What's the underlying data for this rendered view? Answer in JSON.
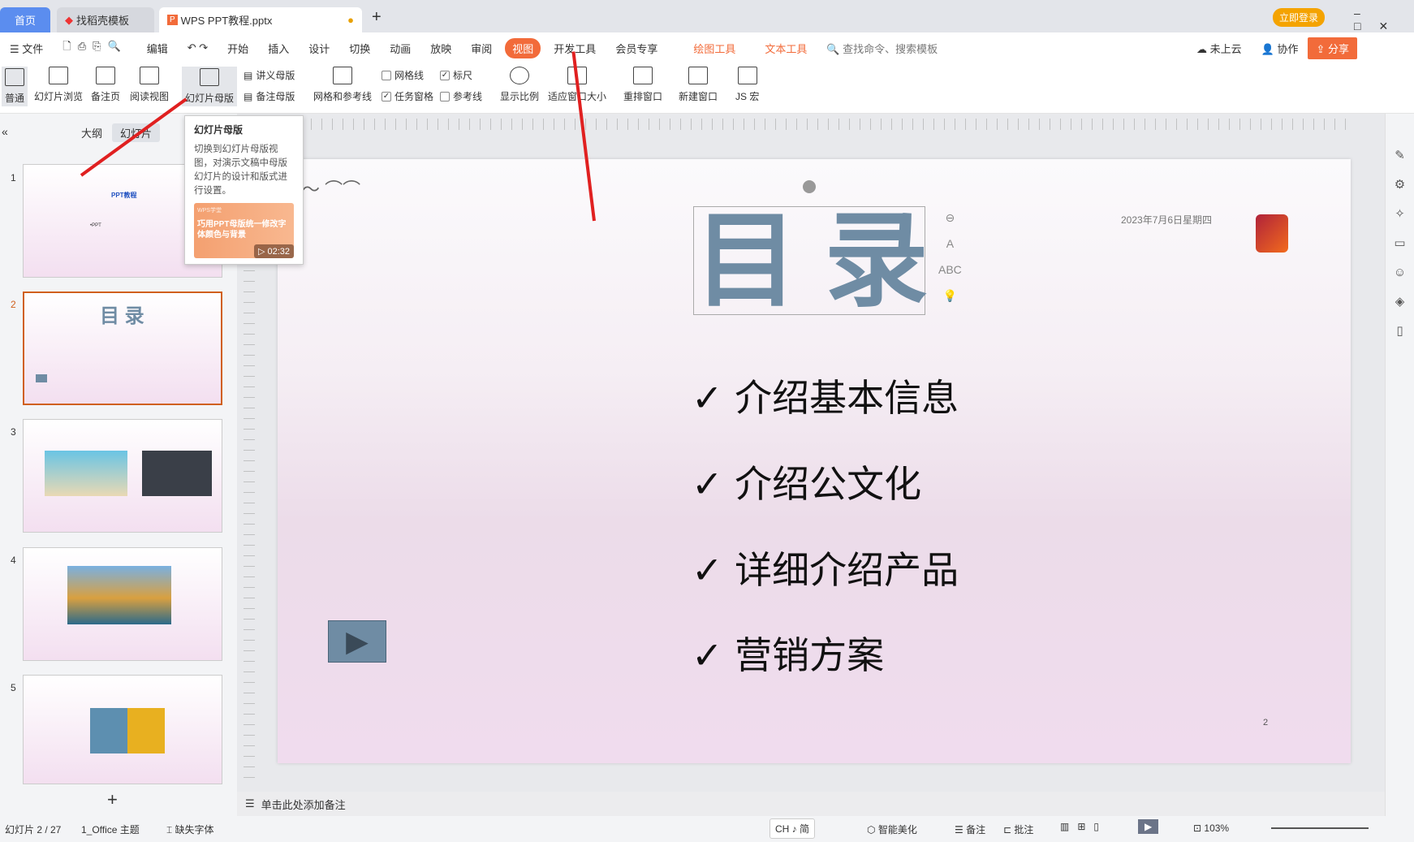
{
  "tabs": [
    {
      "label": "首页"
    },
    {
      "label": "找稻壳模板"
    },
    {
      "label": "WPS PPT教程.pptx"
    }
  ],
  "titlebar": {
    "login": "立即登录",
    "new_tab": "+"
  },
  "menu": {
    "file": "文件",
    "edit": "编辑",
    "items": [
      "开始",
      "插入",
      "设计",
      "切换",
      "动画",
      "放映",
      "审阅",
      "视图",
      "开发工具",
      "会员专享"
    ],
    "active": "视图",
    "tool_tabs": [
      "绘图工具",
      "文本工具"
    ],
    "search_placeholder": "查找命令、搜索模板",
    "cloud": "未上云",
    "collab": "协作",
    "share": "分享"
  },
  "ribbon": {
    "normal": "普通",
    "sorter": "幻灯片浏览",
    "notes_page": "备注页",
    "reading": "阅读视图",
    "slide_master": "幻灯片母版",
    "handout_master": "讲义母版",
    "notes_master": "备注母版",
    "grid_guides": "网格和参考线",
    "gridlines": "网格线",
    "ruler": "标尺",
    "task_pane": "任务窗格",
    "guides": "参考线",
    "zoom": "显示比例",
    "fit": "适应窗口大小",
    "arrange": "重排窗口",
    "new_window": "新建窗口",
    "js": "JS 宏",
    "checks": {
      "gridlines": false,
      "ruler": true,
      "task_pane": true,
      "guides": false
    }
  },
  "tooltip": {
    "title": "幻灯片母版",
    "body": "切换到幻灯片母版视图，对演示文稿中母版幻灯片的设计和版式进行设置。",
    "video_brand": "WPS学堂",
    "video_title": "巧用PPT母版统一修改字体颜色与背景",
    "duration": "02:32"
  },
  "panel": {
    "outline": "大纲",
    "slides": "幻灯片",
    "add": "+"
  },
  "thumbs": [
    {
      "num": "1",
      "title": "PPT教程",
      "sub": "•PPT"
    },
    {
      "num": "2",
      "title": "目 录"
    },
    {
      "num": "3"
    },
    {
      "num": "4"
    },
    {
      "num": "5"
    }
  ],
  "slide": {
    "title": "目 录",
    "date": "2023年7月6日星期四",
    "items": [
      "介绍基本信息",
      "介绍公文化",
      "详细介绍产品",
      "营销方案"
    ],
    "check": "✓",
    "page": "2"
  },
  "notes": {
    "placeholder": "单击此处添加备注"
  },
  "status": {
    "slide": "幻灯片 2 / 27",
    "theme": "1_Office 主题",
    "font": "缺失字体",
    "ime": "CH ♪ 简",
    "beautify": "智能美化",
    "notes": "备注",
    "comments": "批注",
    "zoom": "103%"
  },
  "colors": {
    "accent": "#f26b3a",
    "tab_home": "#5b8def",
    "title_text": "#6f8ca4",
    "login": "#f4a300"
  }
}
